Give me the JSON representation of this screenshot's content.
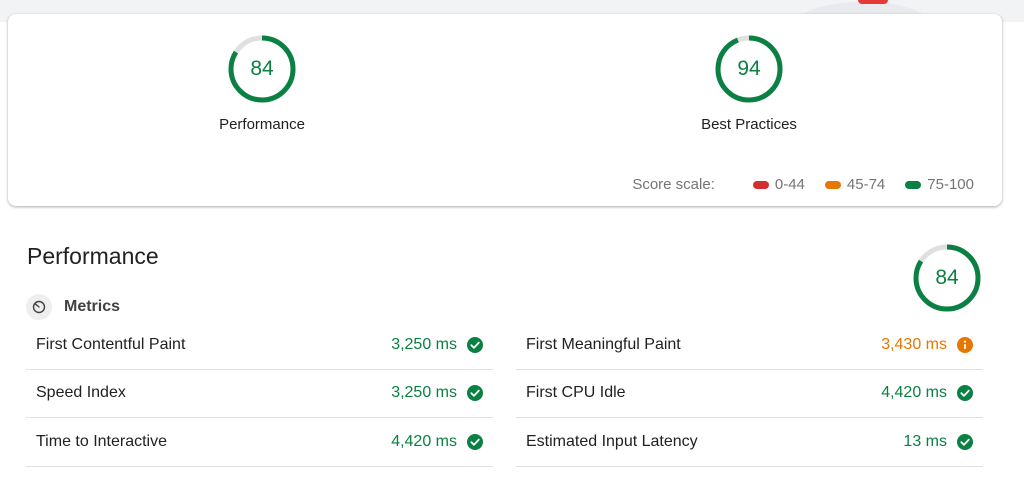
{
  "summary": {
    "gauges": [
      {
        "label": "Performance",
        "score": "84",
        "fraction": 0.84
      },
      {
        "label": "Best Practices",
        "score": "94",
        "fraction": 0.94
      }
    ],
    "scale": {
      "title": "Score scale:",
      "ranges": [
        {
          "label": "0-44",
          "color": "#d32f2f"
        },
        {
          "label": "45-74",
          "color": "#e67700"
        },
        {
          "label": "75-100",
          "color": "#0b8043"
        }
      ]
    }
  },
  "performance": {
    "title": "Performance",
    "score": "84",
    "fraction": 0.84,
    "metrics_title": "Metrics",
    "metrics_icon": "timer-icon",
    "left": [
      {
        "label": "First Contentful Paint",
        "value": "3,250 ms",
        "status": "pass"
      },
      {
        "label": "Speed Index",
        "value": "3,250 ms",
        "status": "pass"
      },
      {
        "label": "Time to Interactive",
        "value": "4,420 ms",
        "status": "pass"
      }
    ],
    "right": [
      {
        "label": "First Meaningful Paint",
        "value": "3,430 ms",
        "status": "average"
      },
      {
        "label": "First CPU Idle",
        "value": "4,420 ms",
        "status": "pass"
      },
      {
        "label": "Estimated Input Latency",
        "value": "13 ms",
        "status": "pass"
      }
    ]
  },
  "colors": {
    "pass": "#0b8043",
    "average": "#e67700",
    "fail": "#d32f2f",
    "gauge_track": "#e0e0e0"
  }
}
